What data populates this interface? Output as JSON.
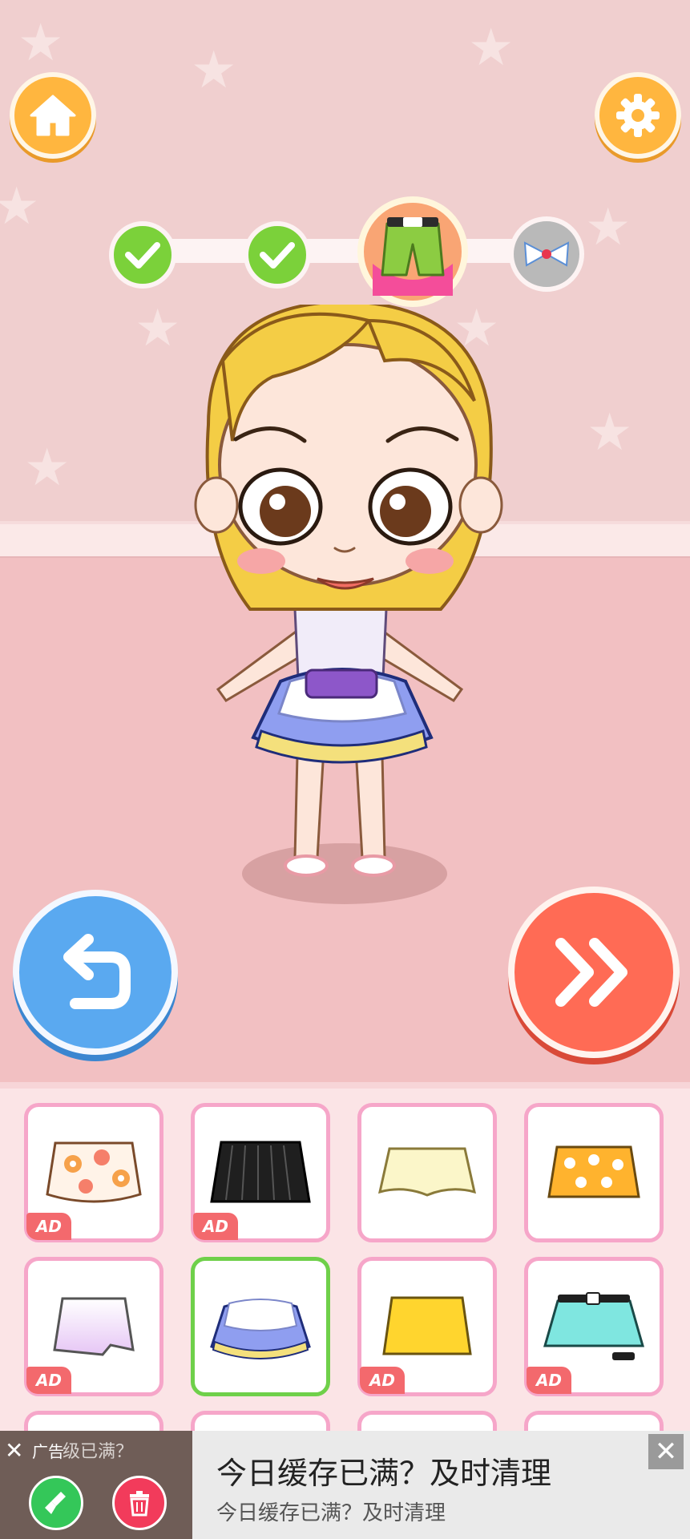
{
  "top_bar": {
    "home_icon": "house-icon",
    "settings_icon": "gear-icon"
  },
  "progress": {
    "steps": [
      {
        "state": "done",
        "icon": "checkmark-icon"
      },
      {
        "state": "done",
        "icon": "checkmark-icon"
      },
      {
        "state": "current",
        "icon": "shorts-icon"
      },
      {
        "state": "upcoming",
        "icon": "bow-icon"
      }
    ]
  },
  "controls": {
    "undo_icon": "undo-arrow-icon",
    "next_icon": "double-chevron-right-icon"
  },
  "wardrobe": {
    "ad_badge": "AD",
    "items": [
      {
        "name": "floral-skirt",
        "ad": true,
        "selected": false
      },
      {
        "name": "black-pleated-skirt",
        "ad": true,
        "selected": false
      },
      {
        "name": "cream-skirt",
        "ad": false,
        "selected": false
      },
      {
        "name": "orange-polka-dot-skirt",
        "ad": false,
        "selected": false
      },
      {
        "name": "lilac-skirt",
        "ad": true,
        "selected": false
      },
      {
        "name": "blue-ruffle-skirt",
        "ad": false,
        "selected": true
      },
      {
        "name": "yellow-skirt",
        "ad": true,
        "selected": false
      },
      {
        "name": "teal-belted-skirt",
        "ad": true,
        "selected": false
      }
    ]
  },
  "ad_banner": {
    "label": "广告",
    "faded_text": "级已满？",
    "title": "今日缓存已满？及时清理",
    "subtitle": "今日缓存已满？及时清理",
    "close_icon": "close-icon",
    "dismiss_label": "✕"
  },
  "colors": {
    "wall": "#f0cfcf",
    "floor": "#f2c0c2",
    "orange_button": "#ffb63f",
    "blue_button": "#5aa9f0",
    "red_button": "#ff6b55",
    "tile_border": "#f6a6c9",
    "selected_border": "#6fd04a",
    "ad_badge": "#f3696d"
  }
}
